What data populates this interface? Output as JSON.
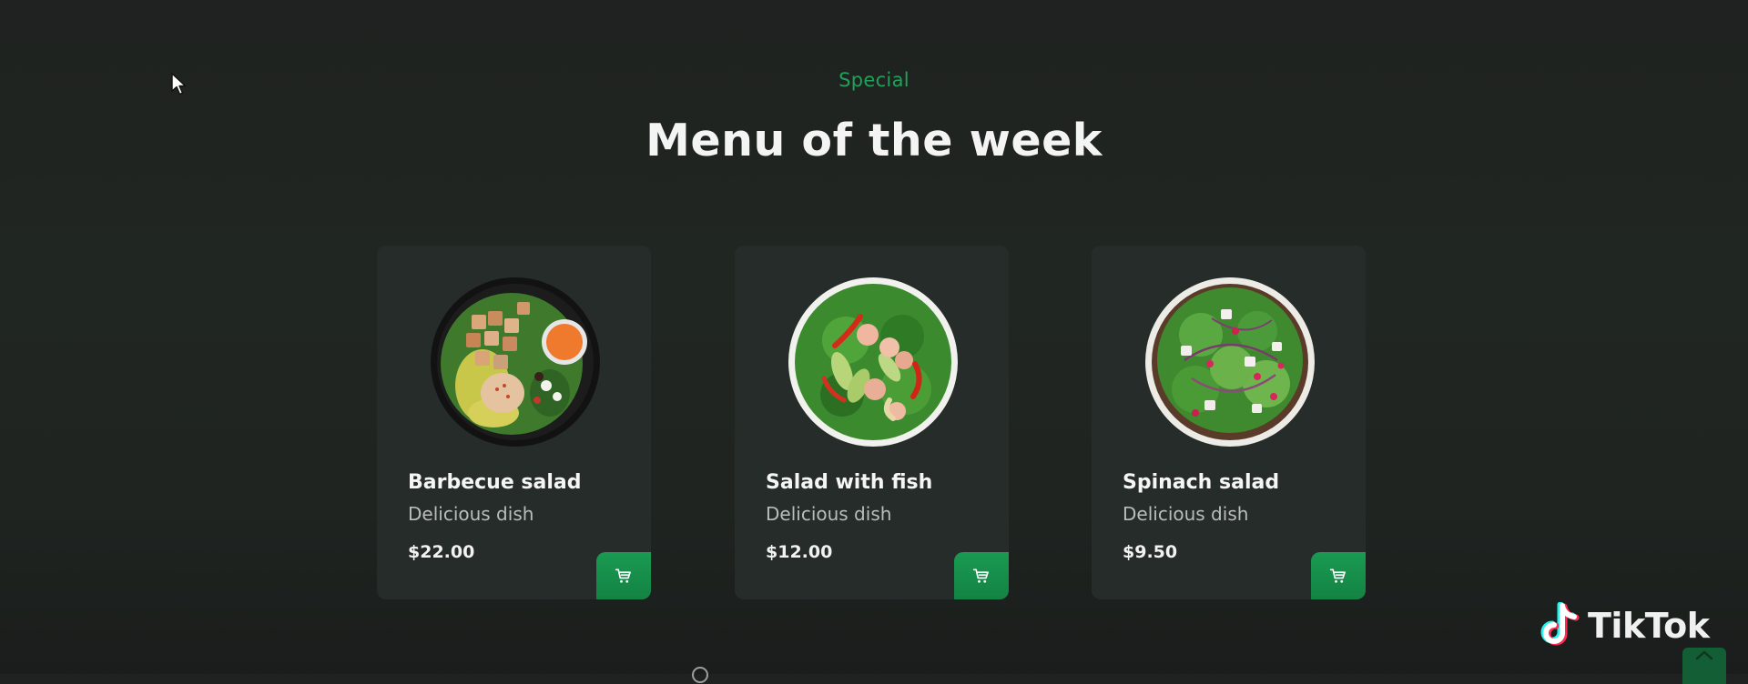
{
  "section": {
    "subtitle": "Special",
    "title": "Menu of the week"
  },
  "menu": {
    "items": [
      {
        "name": "Barbecue salad",
        "description": "Delicious dish",
        "price": "$22.00"
      },
      {
        "name": "Salad with fish",
        "description": "Delicious dish",
        "price": "$12.00"
      },
      {
        "name": "Spinach salad",
        "description": "Delicious dish",
        "price": "$9.50"
      }
    ],
    "cart_icon": "shopping-cart-icon"
  },
  "watermark": {
    "text": "TikTok",
    "icon": "tiktok-logo-icon"
  },
  "colors": {
    "accent": "#1fa15a",
    "card_background": "#262c2a",
    "page_background": "#202622"
  }
}
